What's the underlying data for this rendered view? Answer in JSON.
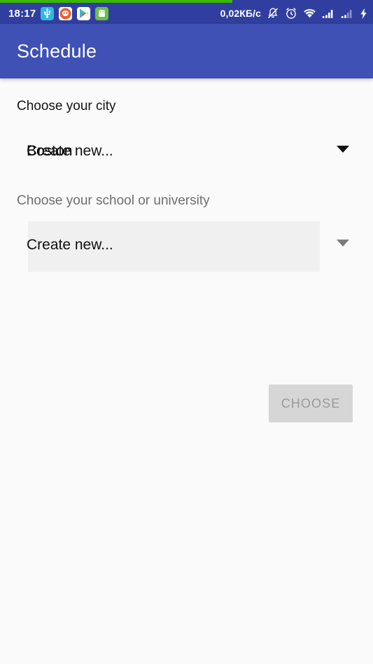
{
  "status_bar": {
    "clock": "18:17",
    "network_speed": "0,02КБ/c",
    "tray_icons": [
      {
        "name": "usb-icon",
        "label": "USB"
      },
      {
        "name": "orange-app-icon",
        "label": "App"
      },
      {
        "name": "google-play-icon",
        "label": "Play Store"
      },
      {
        "name": "android-app-icon",
        "label": "Android app"
      }
    ],
    "system_icons": [
      {
        "name": "notifications-muted-icon",
        "label": "Notifications muted"
      },
      {
        "name": "alarm-clock-icon",
        "label": "Alarm set"
      },
      {
        "name": "wifi-icon",
        "label": "Wi-Fi"
      },
      {
        "name": "signal-sim1-icon",
        "label": "SIM 1 signal"
      },
      {
        "name": "signal-sim2-icon",
        "label": "SIM 2 signal"
      },
      {
        "name": "battery-charging-icon",
        "label": "Charging"
      }
    ],
    "background_color": "#303f9f",
    "recording_indicator_color": "#3bb900"
  },
  "app_bar": {
    "title": "Schedule",
    "background_color": "#3f51b5",
    "text_color": "#ffffff"
  },
  "form": {
    "city": {
      "label": "Choose your city",
      "selected_value": "Create new...",
      "previous_value": "Boston",
      "arrow_icon": "chevron-down-icon"
    },
    "school": {
      "label": "Choose your school or university",
      "selected_value": "Create new...",
      "previous_value": "Create new...",
      "arrow_icon": "chevron-down-icon",
      "highlight_color": "#f0f0f0"
    }
  },
  "actions": {
    "choose_button": {
      "label": "CHOOSE",
      "enabled": false,
      "background_color": "#d6d6d6",
      "text_color": "#9a9a9a"
    }
  },
  "page": {
    "background_color": "#fafafa"
  }
}
